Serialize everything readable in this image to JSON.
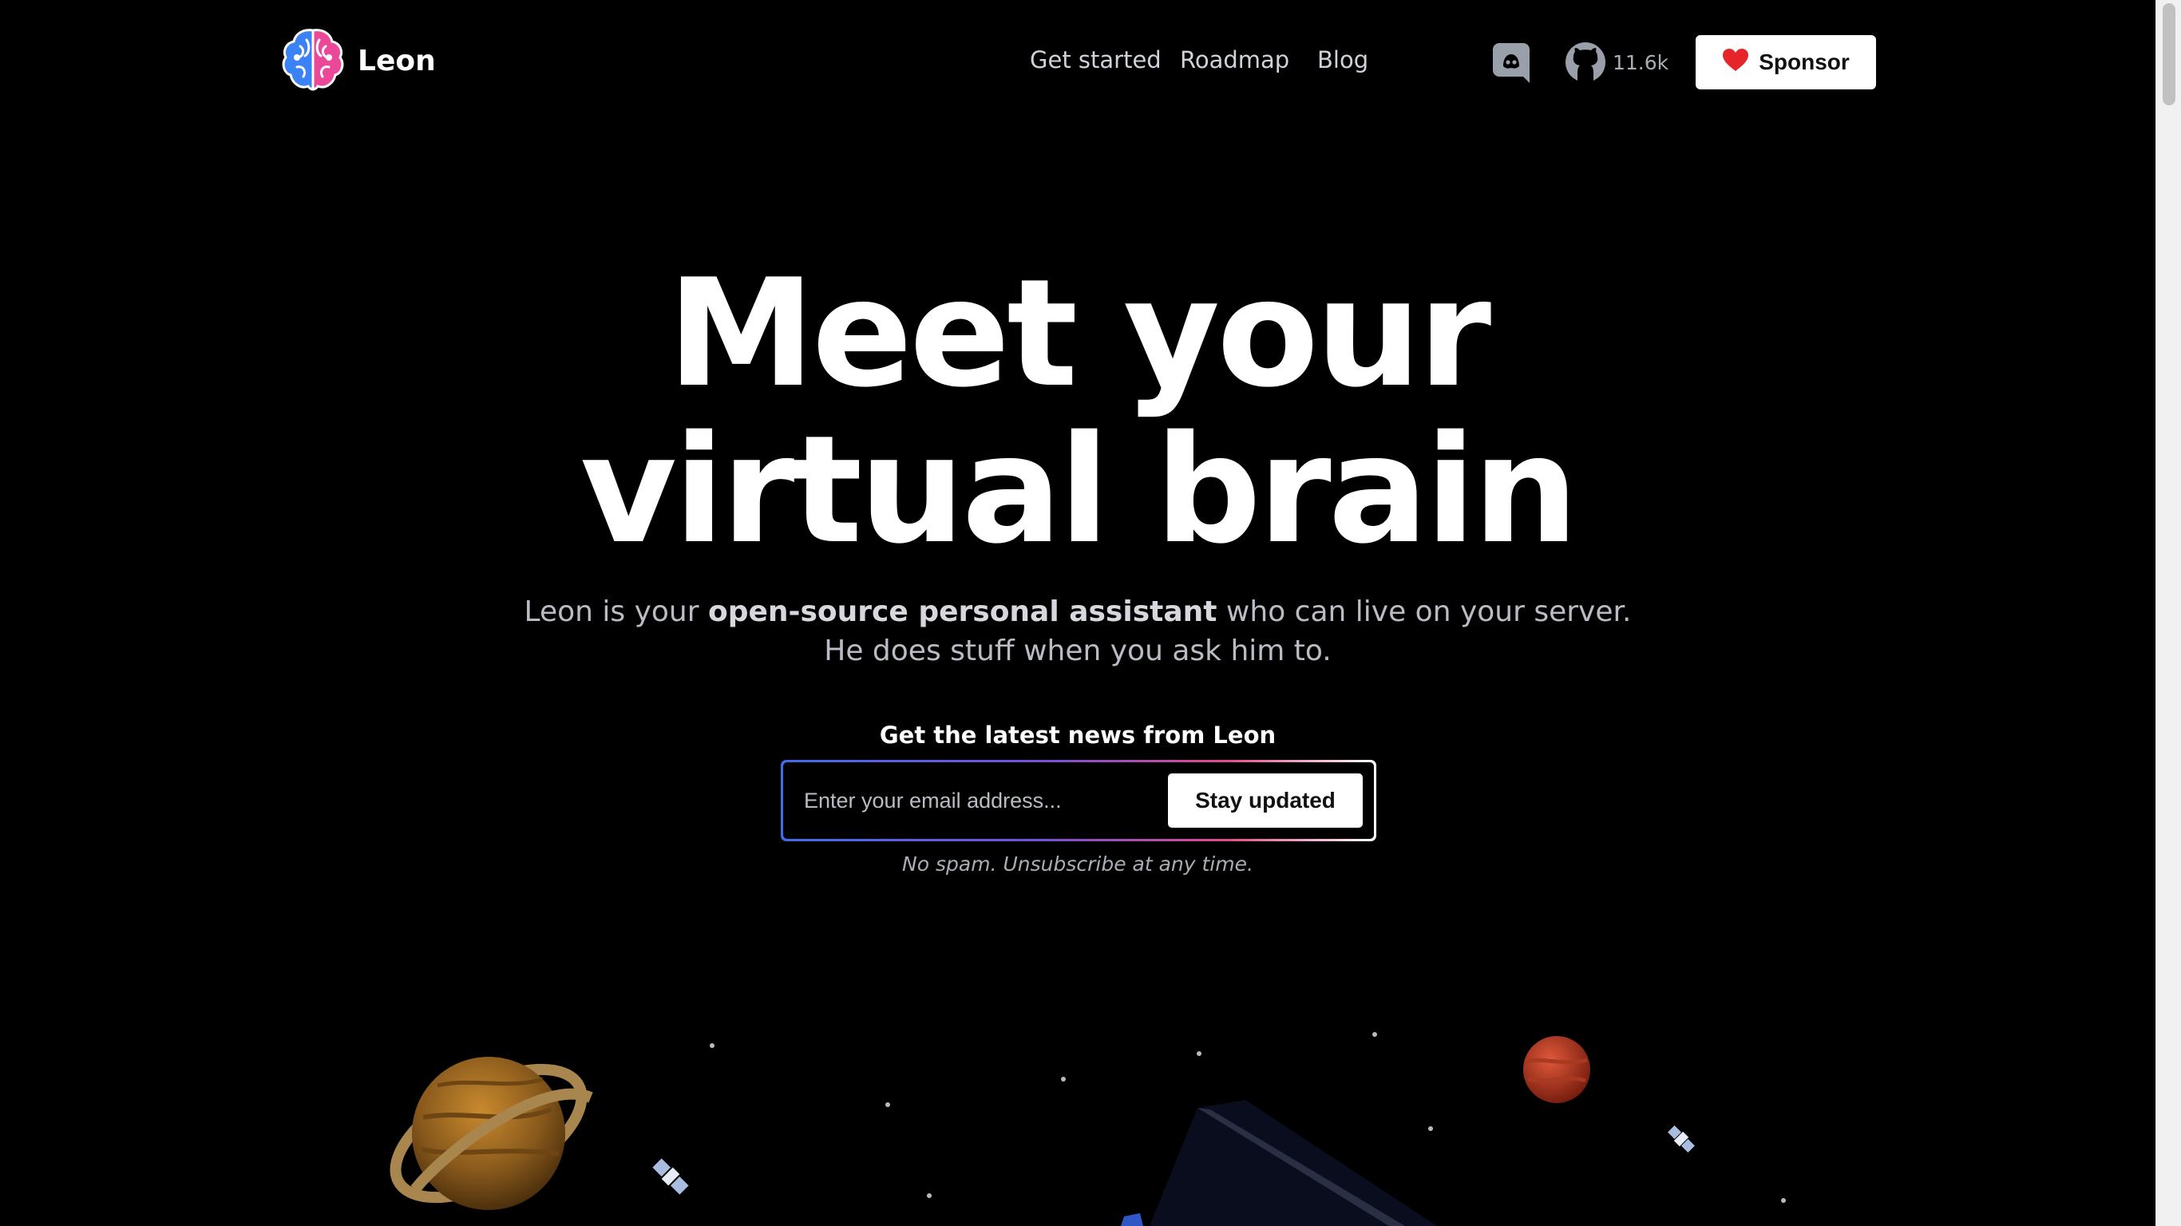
{
  "brand": {
    "name": "Leon",
    "logo_icon": "brain-icon"
  },
  "nav": {
    "links": [
      "Get started",
      "Roadmap",
      "Blog"
    ],
    "github_stars": "11.6k",
    "sponsor_label": "Sponsor"
  },
  "hero": {
    "title_line1": "Meet your",
    "title_line2": "virtual brain",
    "subtitle_pre": "Leon is your ",
    "subtitle_bold": "open-source personal assistant",
    "subtitle_post": " who can live on your server.",
    "subtitle_line2": "He does stuff when you ask him to."
  },
  "newsletter": {
    "label": "Get the latest news from Leon",
    "email_placeholder": "Enter your email address...",
    "button_label": "Stay updated",
    "note": "No spam. Unsubscribe at any time."
  },
  "colors": {
    "background": "#000000",
    "brain_left": "#3b82f6",
    "brain_right": "#ec4899",
    "gradient": [
      "#3f6dea",
      "#7b4fd6",
      "#e24a8e",
      "#ffffff"
    ]
  }
}
